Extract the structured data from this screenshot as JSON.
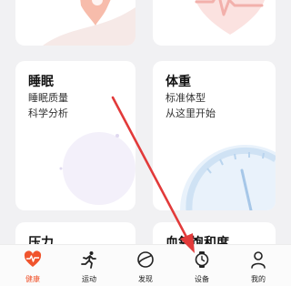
{
  "cards": {
    "sleep": {
      "title": "睡眠",
      "line1": "睡眠质量",
      "line2": "科学分析"
    },
    "weight": {
      "title": "体重",
      "line1": "标准体型",
      "line2": "从这里开始"
    },
    "stress": {
      "title": "压力"
    },
    "spo2": {
      "title": "血氧饱和度"
    }
  },
  "tabbar": {
    "tabs": [
      {
        "label": "健康",
        "icon": "heart-pulse-icon",
        "active": true
      },
      {
        "label": "运动",
        "icon": "running-icon",
        "active": false
      },
      {
        "label": "发现",
        "icon": "discover-icon",
        "active": false
      },
      {
        "label": "设备",
        "icon": "watch-icon",
        "active": false
      },
      {
        "label": "我的",
        "icon": "person-icon",
        "active": false
      }
    ]
  },
  "colors": {
    "accent": "#f0542d",
    "arrow": "#e23a3a",
    "background": "#f1f1f3",
    "card": "#ffffff"
  }
}
